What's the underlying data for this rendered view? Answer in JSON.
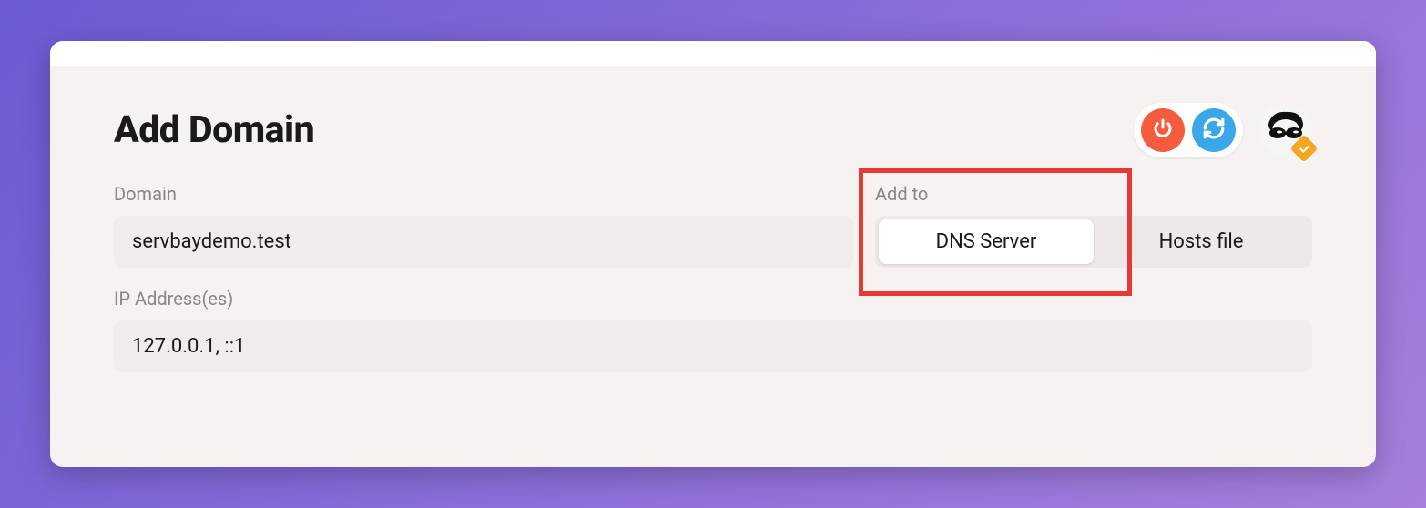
{
  "page": {
    "title": "Add Domain"
  },
  "fields": {
    "domain": {
      "label": "Domain",
      "value": "servbaydemo.test"
    },
    "add_to": {
      "label": "Add to",
      "options": {
        "dns_server": "DNS Server",
        "hosts_file": "Hosts file"
      },
      "selected": "dns_server"
    },
    "ip_addresses": {
      "label": "IP Address(es)",
      "value": "127.0.0.1, ::1"
    }
  },
  "icons": {
    "power": "power-icon",
    "refresh": "refresh-icon",
    "avatar_badge": "verified-badge"
  }
}
